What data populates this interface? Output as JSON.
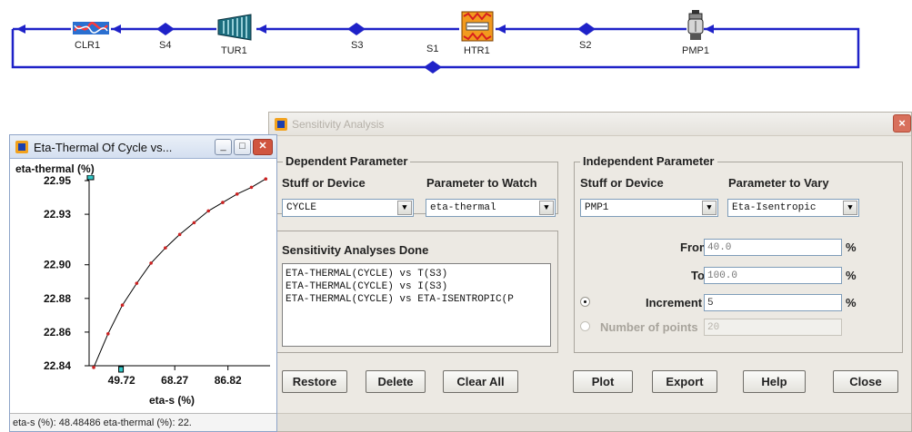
{
  "diagram": {
    "components": [
      {
        "id": "clr1",
        "label": "CLR1",
        "icon": "cooler-icon"
      },
      {
        "id": "s4",
        "label": "S4",
        "icon": "state-node"
      },
      {
        "id": "tur1",
        "label": "TUR1",
        "icon": "turbine-icon"
      },
      {
        "id": "s3",
        "label": "S3",
        "icon": "state-node"
      },
      {
        "id": "s1",
        "label": "S1",
        "icon": "state-node"
      },
      {
        "id": "htr1",
        "label": "HTR1",
        "icon": "heater-icon"
      },
      {
        "id": "s2",
        "label": "S2",
        "icon": "state-node"
      },
      {
        "id": "pmp1",
        "label": "PMP1",
        "icon": "pump-icon"
      }
    ],
    "line_color": "#1f22c8"
  },
  "sensitivity": {
    "title": "Sensitivity Analysis",
    "dependent": {
      "group_title": "Dependent Parameter",
      "stuff_label": "Stuff or Device",
      "stuff_value": "CYCLE",
      "param_label": "Parameter to Watch",
      "param_value": "eta-thermal"
    },
    "done": {
      "group_title": "Sensitivity Analyses Done",
      "items": [
        "ETA-THERMAL(CYCLE) vs T(S3)",
        "ETA-THERMAL(CYCLE) vs I(S3)",
        "ETA-THERMAL(CYCLE) vs ETA-ISENTROPIC(P"
      ]
    },
    "independent": {
      "group_title": "Independent Parameter",
      "stuff_label": "Stuff or Device",
      "stuff_value": "PMP1",
      "param_label": "Parameter to Vary",
      "param_value": "Eta-Isentropic",
      "from_label": "From",
      "from_value": "40.0",
      "to_label": "To",
      "to_value": "100.0",
      "increment_label": "Increment",
      "increment_value": "5",
      "npoints_label": "Number of points",
      "npoints_value": "20",
      "unit": "%"
    },
    "buttons": {
      "restore": "Restore",
      "delete": "Delete",
      "clear_all": "Clear All",
      "plot": "Plot",
      "export": "Export",
      "help": "Help",
      "close": "Close"
    }
  },
  "plot_window": {
    "title": "Eta-Thermal Of Cycle vs...",
    "y_axis_title": "eta-thermal (%)",
    "x_axis_title": "eta-s (%)",
    "status": "eta-s (%): 48.48486  eta-thermal (%): 22."
  },
  "chart_data": {
    "type": "line",
    "x_ticks": [
      "49.72",
      "68.27",
      "86.82"
    ],
    "y_ticks": [
      "22.84",
      "22.86",
      "22.88",
      "22.90",
      "22.93",
      "22.95"
    ],
    "xlim": [
      38.4,
      101.5
    ],
    "x": [
      40,
      45,
      50,
      55,
      60,
      65,
      70,
      75,
      80,
      85,
      90,
      95,
      100
    ],
    "series": [
      {
        "values": [
          22.839,
          22.859,
          22.876,
          22.889,
          22.901,
          22.91,
          22.918,
          22.925,
          22.932,
          22.937,
          22.942,
          22.946,
          22.951
        ]
      }
    ],
    "line_color": "#000000",
    "marker_color": "#cc2222",
    "grid": false
  }
}
